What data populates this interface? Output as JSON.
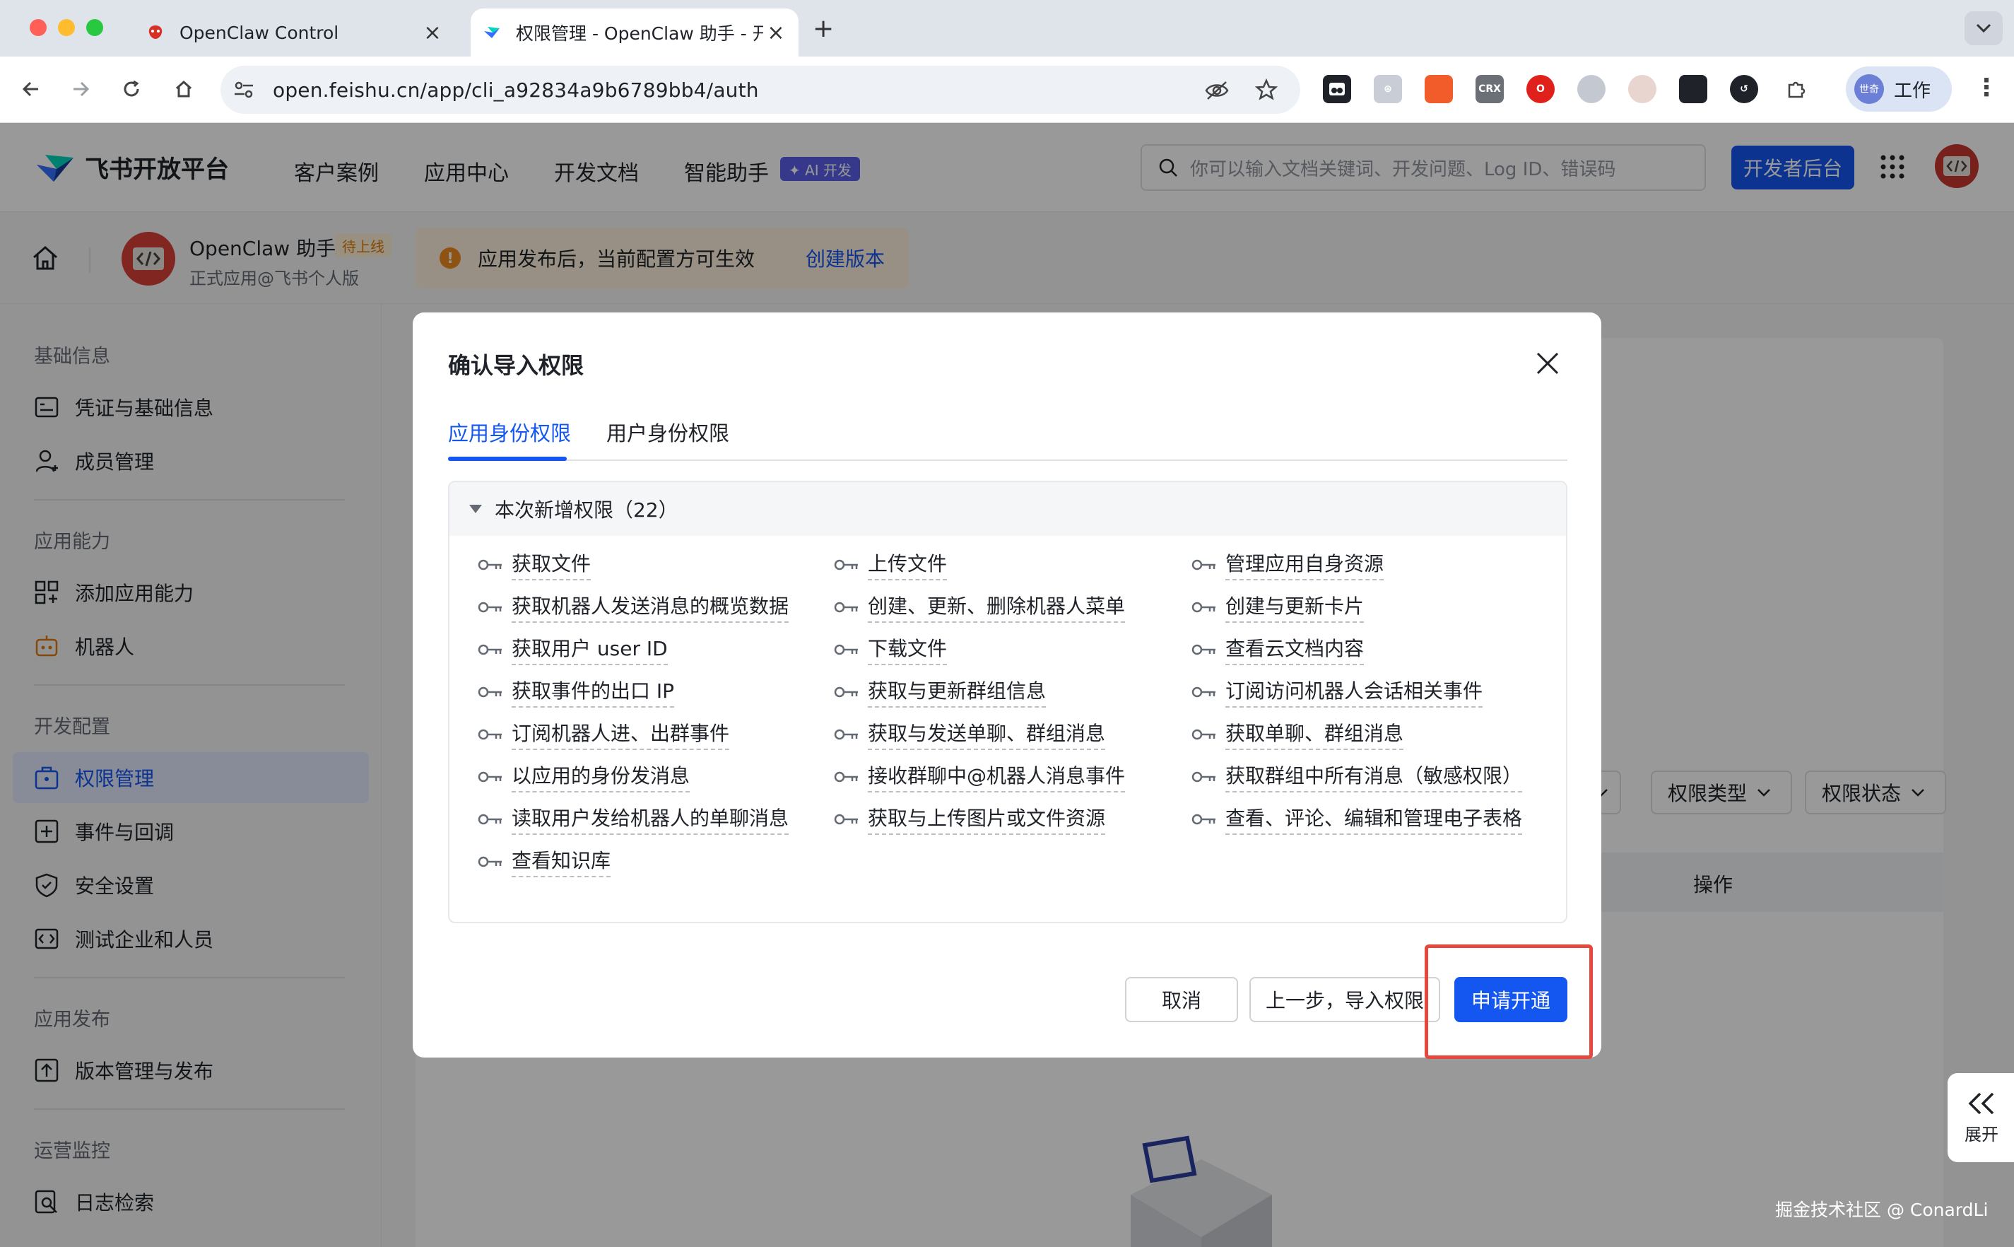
{
  "browser": {
    "tabs": [
      {
        "title": "OpenClaw Control",
        "active": false
      },
      {
        "title": "权限管理 - OpenClaw 助手 - 开",
        "active": true
      }
    ],
    "url": "open.feishu.cn/app/cli_a92834a9b6789bb4/auth",
    "profile_label": "工作",
    "profile_avatar": "世奇",
    "ext_crx": "CRX"
  },
  "header": {
    "brand": "飞书开放平台",
    "nav": [
      "客户案例",
      "应用中心",
      "开发文档",
      "智能助手"
    ],
    "ai_badge": "✦ AI 开发",
    "search_placeholder": "你可以输入文档关键词、开发问题、Log ID、错误码",
    "dev_button": "开发者后台"
  },
  "app": {
    "name": "OpenClaw 助手",
    "status": "待上线",
    "subtitle": "正式应用@飞书个人版",
    "notice": "应用发布后，当前配置方可生效",
    "notice_link": "创建版本"
  },
  "sidebar": {
    "sections": [
      {
        "title": "基础信息",
        "items": [
          {
            "label": "凭证与基础信息",
            "icon": "credential-icon"
          },
          {
            "label": "成员管理",
            "icon": "member-icon"
          }
        ]
      },
      {
        "title": "应用能力",
        "items": [
          {
            "label": "添加应用能力",
            "icon": "add-capability-icon"
          },
          {
            "label": "机器人",
            "icon": "robot-icon"
          }
        ]
      },
      {
        "title": "开发配置",
        "items": [
          {
            "label": "权限管理",
            "icon": "permission-icon",
            "active": true
          },
          {
            "label": "事件与回调",
            "icon": "event-icon"
          },
          {
            "label": "安全设置",
            "icon": "shield-icon"
          },
          {
            "label": "测试企业和人员",
            "icon": "test-icon"
          }
        ]
      },
      {
        "title": "应用发布",
        "items": [
          {
            "label": "版本管理与发布",
            "icon": "version-icon"
          }
        ]
      },
      {
        "title": "运营监控",
        "items": [
          {
            "label": "日志检索",
            "icon": "log-search-icon"
          }
        ]
      }
    ]
  },
  "background": {
    "filters": [
      "权限类型",
      "权限状态"
    ],
    "table_header_action": "操作"
  },
  "modal": {
    "title": "确认导入权限",
    "tabs": [
      "应用身份权限",
      "用户身份权限"
    ],
    "section_title": "本次新增权限（22）",
    "permissions": [
      [
        "获取文件",
        "上传文件",
        "管理应用自身资源"
      ],
      [
        "获取机器人发送消息的概览数据",
        "创建、更新、删除机器人菜单",
        "创建与更新卡片"
      ],
      [
        "获取用户 user ID",
        "下载文件",
        "查看云文档内容"
      ],
      [
        "获取事件的出口 IP",
        "获取与更新群组信息",
        "订阅访问机器人会话相关事件"
      ],
      [
        "订阅机器人进、出群事件",
        "获取与发送单聊、群组消息",
        "获取单聊、群组消息"
      ],
      [
        "以应用的身份发消息",
        "接收群聊中@机器人消息事件",
        "获取群组中所有消息（敏感权限）"
      ],
      [
        "读取用户发给机器人的单聊消息",
        "获取与上传图片或文件资源",
        "查看、评论、编辑和管理电子表格"
      ],
      [
        "查看知识库"
      ]
    ],
    "buttons": {
      "cancel": "取消",
      "previous": "上一步，导入权限",
      "apply": "申请开通"
    }
  },
  "expand_label": "展开",
  "watermark": "掘金技术社区 @ ConardLi",
  "colors": {
    "primary": "#1456f0",
    "highlight": "#e6483d",
    "warning": "#ed8b1f"
  }
}
